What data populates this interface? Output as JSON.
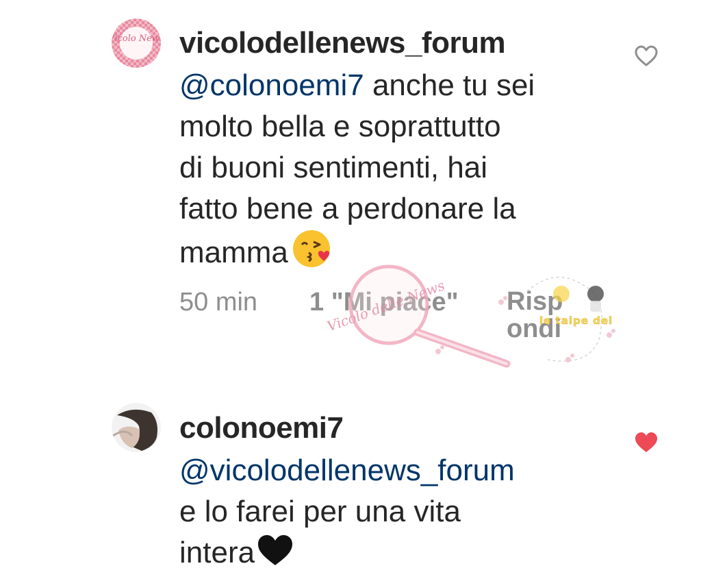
{
  "comments": [
    {
      "username": "vicolodellenews_forum",
      "mention": "@colonoemi7",
      "text_lines": [
        "anche tu sei",
        "molto bella e soprattutto",
        "di buoni sentimenti, hai",
        "fatto bene a perdonare la",
        "mamma"
      ],
      "emoji": "kissing-face-with-heart-emoji",
      "time": "50 min",
      "likes": "1 \"Mi piace\"",
      "reply_label_top": "Risp",
      "reply_label_bottom": "ondi",
      "liked": false,
      "avatar_text": "Vicolo News"
    },
    {
      "username": "colonoemi7",
      "mention": "@vicolodellenews_forum",
      "text_lines": [
        "e lo farei per una vita",
        "intera"
      ],
      "emoji": "black-heart-emoji",
      "liked": true
    }
  ],
  "watermark": {
    "logo_text": "Vicolo delle News",
    "tagline": "le talpe del web"
  },
  "colors": {
    "text": "#262626",
    "mention": "#003569",
    "meta": "#8e8e8e",
    "heart_liked": "#ed4956",
    "heart_outline": "#8e8e8e"
  }
}
